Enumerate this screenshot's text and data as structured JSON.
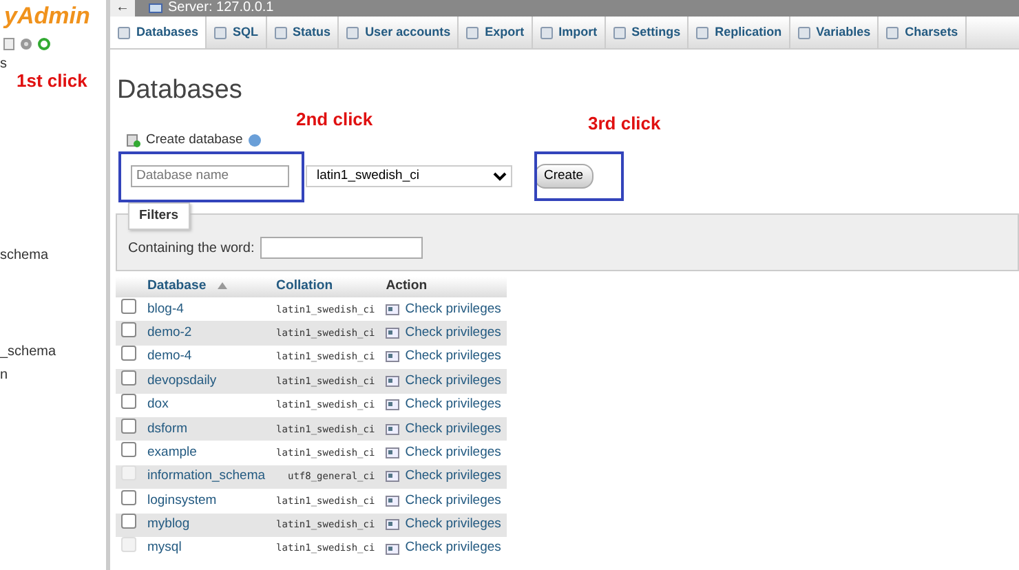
{
  "sidebar": {
    "logo": "yAdmin",
    "items": [
      "s",
      "schema",
      "_schema",
      "n"
    ]
  },
  "top_bar": {
    "back": "←",
    "title": "Server: 127.0.0.1"
  },
  "tabs": [
    {
      "label": "Databases",
      "selected": true
    },
    {
      "label": "SQL",
      "selected": false
    },
    {
      "label": "Status",
      "selected": false
    },
    {
      "label": "User accounts",
      "selected": false
    },
    {
      "label": "Export",
      "selected": false
    },
    {
      "label": "Import",
      "selected": false
    },
    {
      "label": "Settings",
      "selected": false
    },
    {
      "label": "Replication",
      "selected": false
    },
    {
      "label": "Variables",
      "selected": false
    },
    {
      "label": "Charsets",
      "selected": false
    }
  ],
  "heading": "Databases",
  "create_database": {
    "label": "Create database",
    "name_placeholder": "Database name",
    "collation": "latin1_swedish_ci",
    "button": "Create"
  },
  "filters": {
    "legend": "Filters",
    "label": "Containing the word:"
  },
  "table": {
    "columns": [
      "Database",
      "Collation",
      "Action"
    ],
    "rows": [
      {
        "database": "blog-4",
        "collation": "latin1_swedish_ci",
        "action": "Check privileges",
        "disabled": false
      },
      {
        "database": "demo-2",
        "collation": "latin1_swedish_ci",
        "action": "Check privileges",
        "disabled": false
      },
      {
        "database": "demo-4",
        "collation": "latin1_swedish_ci",
        "action": "Check privileges",
        "disabled": false
      },
      {
        "database": "devopsdaily",
        "collation": "latin1_swedish_ci",
        "action": "Check privileges",
        "disabled": false
      },
      {
        "database": "dox",
        "collation": "latin1_swedish_ci",
        "action": "Check privileges",
        "disabled": false
      },
      {
        "database": "dsform",
        "collation": "latin1_swedish_ci",
        "action": "Check privileges",
        "disabled": false
      },
      {
        "database": "example",
        "collation": "latin1_swedish_ci",
        "action": "Check privileges",
        "disabled": false
      },
      {
        "database": "information_schema",
        "collation": "utf8_general_ci",
        "action": "Check privileges",
        "disabled": true
      },
      {
        "database": "loginsystem",
        "collation": "latin1_swedish_ci",
        "action": "Check privileges",
        "disabled": false
      },
      {
        "database": "myblog",
        "collation": "latin1_swedish_ci",
        "action": "Check privileges",
        "disabled": false
      },
      {
        "database": "mysql",
        "collation": "latin1_swedish_ci",
        "action": "Check privileges",
        "disabled": true
      }
    ]
  },
  "annotations": [
    "1st click",
    "2nd click",
    "3rd click"
  ]
}
